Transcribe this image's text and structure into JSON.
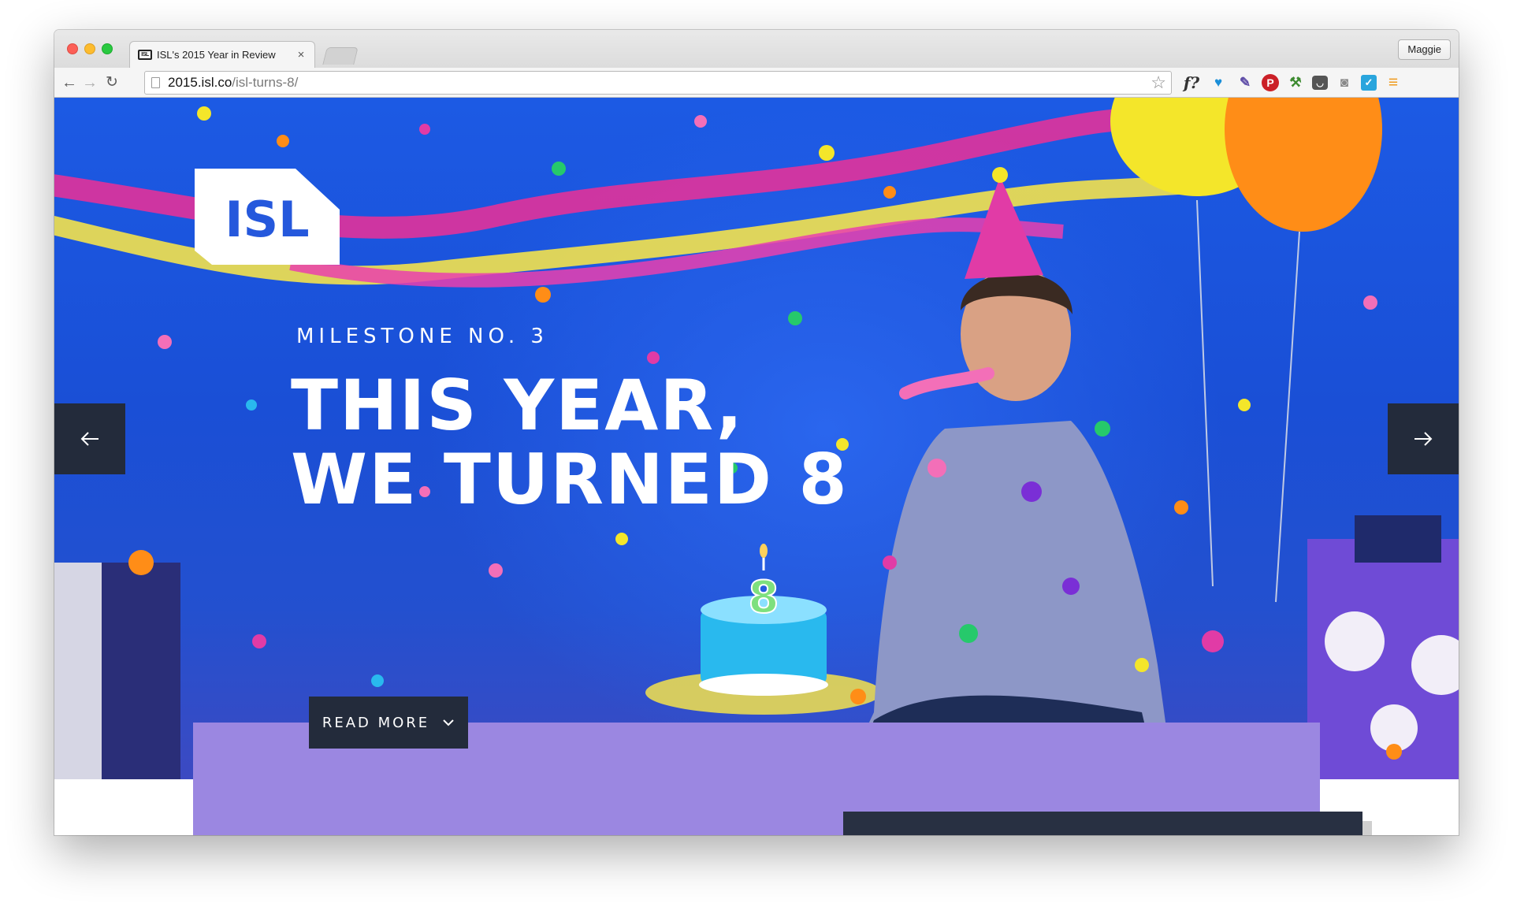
{
  "browser": {
    "tab": {
      "favicon_text": "ISL",
      "title": "ISL's 2015 Year in Review",
      "close": "×"
    },
    "profile": "Maggie",
    "nav": {
      "back": "←",
      "forward": "→",
      "reload": "↻"
    },
    "url": {
      "host": "2015.isl.co",
      "path": "/isl-turns-8/"
    },
    "bookmark_star": "☆",
    "extensions": [
      {
        "name": "fquery-icon",
        "glyph": "f?"
      },
      {
        "name": "heart-extension-icon",
        "glyph": "♥"
      },
      {
        "name": "color-picker-icon",
        "glyph": "✎"
      },
      {
        "name": "pinterest-icon",
        "glyph": "P"
      },
      {
        "name": "ant-icon",
        "glyph": "⚒"
      },
      {
        "name": "pocket-icon",
        "glyph": "◡"
      },
      {
        "name": "camera-icon",
        "glyph": "◙"
      },
      {
        "name": "task-check-icon",
        "glyph": "✓"
      },
      {
        "name": "chrome-menu-icon",
        "glyph": "≡"
      }
    ]
  },
  "hero": {
    "logo_text": "ISL",
    "eyebrow": "MILESTONE NO. 3",
    "headline_line1": "THIS YEAR,",
    "headline_line2": "WE TURNED 8",
    "cake_number": "8",
    "read_more": "READ MORE",
    "prev_arrow": "←",
    "next_arrow": "→"
  },
  "colors": {
    "hero_blue": "#1c5ae4",
    "dark_navy": "#232b3b",
    "lavender_panel": "#9b87e1",
    "streamer_magenta": "#e2329a",
    "streamer_yellow": "#f3e24c",
    "balloon_yellow": "#f4e62a",
    "balloon_orange": "#ff8d17"
  }
}
